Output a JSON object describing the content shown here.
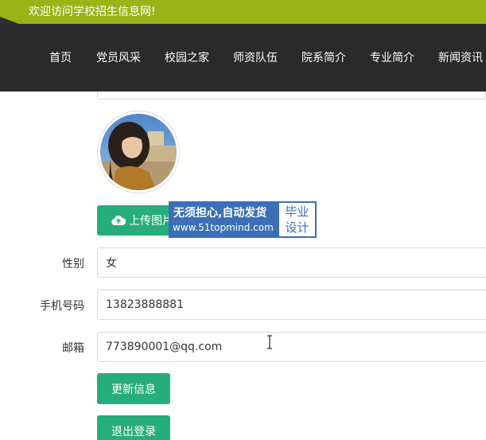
{
  "header": {
    "welcome": "欢迎访问学校招生信息网!"
  },
  "nav": {
    "items": [
      {
        "label": "首页"
      },
      {
        "label": "党员风采"
      },
      {
        "label": "校园之家"
      },
      {
        "label": "师资队伍"
      },
      {
        "label": "院系简介"
      },
      {
        "label": "专业简介"
      },
      {
        "label": "新闻资讯"
      }
    ]
  },
  "profile": {
    "upload_label": "上传图片",
    "gender_label": "性别",
    "gender_value": "女",
    "phone_label": "手机号码",
    "phone_value": "13823888881",
    "email_label": "邮箱",
    "email_value": "773890001@qq.com",
    "update_label": "更新信息",
    "logout_label": "退出登录"
  },
  "watermark": {
    "line1": "无须担心,自动发货",
    "line2": "www.51topmind.com",
    "tag_line1": "毕业",
    "tag_line2": "设计"
  },
  "colors": {
    "accent_green": "#27ad7a",
    "topbar_green": "#9ab317",
    "nav_bg": "#2a2a2a",
    "watermark_blue": "#3b6fb6"
  }
}
